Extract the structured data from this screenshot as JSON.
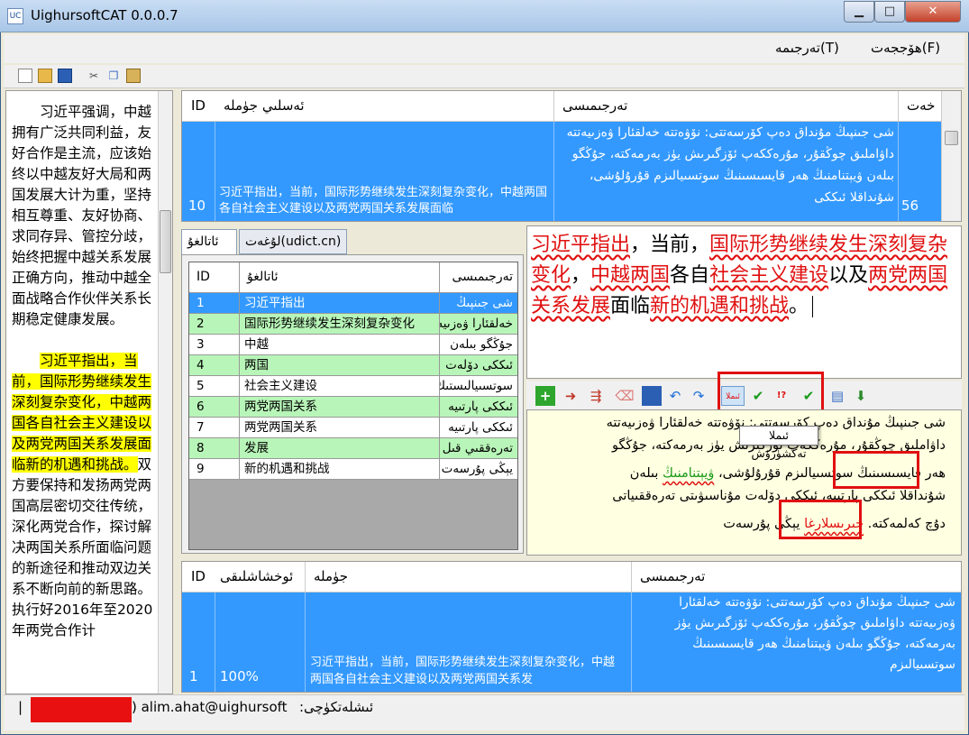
{
  "window": {
    "title": "UighursoftCAT 0.0.0.7",
    "app_icon": "UC",
    "min_symbol": "▁",
    "max_symbol": "□",
    "close_symbol": "✕"
  },
  "menu": {
    "file": "ھۆججەت(F)",
    "translate": "تەرجىمە(T)"
  },
  "toolbar_icons": [
    "new-file-icon",
    "open-folder-icon",
    "save-icon",
    "cut-icon",
    "copy-icon",
    "paste-icon"
  ],
  "left_pane": {
    "para1": "习近平强调，中越拥有广泛共同利益，友好合作是主流，应该始终以中越友好大局和两国发展大计为重，坚持相互尊重、友好协商、求同存异、管控分歧，始终把握中越关系发展正确方向，推动中越全面战略合作伙伴关系长期稳定健康发展。",
    "para2_highlight": "习近平指出，当前，国际形势继续发生深刻复杂变化，中越两国各自社会主义建设以及两党两国关系发展面临新的机遇和挑战。",
    "para2_rest": "双方要保持和发扬两党两国高层密切交往传统，深化两党合作，探讨解决两国关系所面临问题的新途径和推动双边关系不断向前的新思路。执行好2016年至2020年两党合作计"
  },
  "seg_grid": {
    "col_id": "ID",
    "col_source": "ئەسلىي جۈملە",
    "col_target": "تەرجىمىسى",
    "col_chars": "خەت",
    "row": {
      "id": "10",
      "source": "习近平指出，当前，国际形势继续发生深刻复杂变化，中越两国各自社会主义建设以及两党两国关系发展面临",
      "target": "شى جىنپىڭ مۇنداق دەپ كۆرسەتتى: نۆۋەتتە خەلقئارا ۋەزىيەتتە داۋاملىق چوڭقۇر، مۇرەككەپ ئۆزگىرىش يۈز بەرمەكتە، جۇڭگو بىلەن ۋيېتنامنىڭ ھەر قايسىسىنىڭ سوتسىيالىزم قۇرۇلۇشى، شۇنداقلا ئىككى",
      "chars": "56"
    }
  },
  "dict_tabs": {
    "glossary": "ئاتالغۇ",
    "online": "لۇغەت(udict.cn)"
  },
  "dict_grid": {
    "col_id": "ID",
    "col_term": "ئاتالغۇ",
    "col_trans": "تەرجىمىسى",
    "rows": [
      {
        "id": "1",
        "term": "习近平指出",
        "trans": "شى جىنپىڭ"
      },
      {
        "id": "2",
        "term": "国际形势继续发生深刻复杂变化",
        "trans": "خەلقئارا ۋەزىيەت"
      },
      {
        "id": "3",
        "term": "中越",
        "trans": "جۇڭگو بىلەن"
      },
      {
        "id": "4",
        "term": "两国",
        "trans": "ئىككى دۆلەت"
      },
      {
        "id": "5",
        "term": "社会主义建设",
        "trans": "سوتسىيالىستىك"
      },
      {
        "id": "6",
        "term": "两党两国关系",
        "trans": "ئىككى پارتىيە"
      },
      {
        "id": "7",
        "term": "两党两国关系",
        "trans": "ئىككى پارتىيە"
      },
      {
        "id": "8",
        "term": "发展",
        "trans": "تەرەققىي قىل"
      },
      {
        "id": "9",
        "term": "新的机遇和挑战",
        "trans": "يېڭى پۇرسەت"
      }
    ]
  },
  "source_editor": {
    "t1": "习近平指出",
    "t2": "，当前，",
    "t3": "国际形势继续发生深刻复杂变化",
    "t4": "，",
    "t5": "中越两国",
    "t6": "各自",
    "t7": "社会主义建设",
    "t8": "以及",
    "t9": "两党两国关系发展",
    "t10": "面临",
    "t11": "新的机遇和挑战",
    "t12": "。"
  },
  "editor_toolbar": {
    "tooltip": "ئىملا تەكشۈرۈش",
    "spell_label": "ئىملا",
    "icons": [
      "add-icon",
      "insert-icon",
      "export-icon",
      "eraser-icon",
      "save-icon",
      "undo-icon",
      "redo-icon",
      "spellcheck-icon",
      "check-icon",
      "spell-next-icon",
      "check-all-icon",
      "commit-icon",
      "download-icon"
    ]
  },
  "target_editor": {
    "l1": "شى جىنپىڭ مۇنداق دەپ كۆرسەتتى: نۆۋەتتە خەلقئارا ۋەزىيەتتە",
    "l2": "داۋاملىق چوڭقۇر، مۇرەككەپ ئۆزگىرىش يۈز بەرمەكتە، جۇڭگو",
    "l3a": "بىلەن",
    "l3err": "ۋيېتنامنىڭ",
    "l3b": "ھەر قايسىسىنىڭ سوتسىيالىزم قۇرۇلۇشى،",
    "l4": "شۇنداقلا ئىككى پارتىيە، ئىككى دۆلەت مۇناسىۋىتى تەرەققىياتى",
    "l5a": "يېڭى پۇرسەت",
    "l5err": "خىرىسلارغا",
    "l5b": "دۇچ كەلمەكتە."
  },
  "tm_grid": {
    "col_id": "ID",
    "col_match": "ئوخشاشلىقى",
    "col_source": "جۈملە",
    "col_target": "تەرجىمىسى",
    "row": {
      "id": "1",
      "match": "100%",
      "source": "习近平指出，当前，国际形势继续发生深刻复杂变化，中越两国各自社会主义建设以及两党两国关系发",
      "target": "شى جىنپىڭ مۇنداق دەپ كۆرسەتتى: نۆۋەتتە خەلقئارا ۋەزىيەتتە داۋاملىق چوڭقۇر، مۇرەككەپ ئۆزگىرىش يۈز بەرمەكتە، جۇڭگو بىلەن ۋيېتنامنىڭ ھەر قايسىسىنىڭ سوتسىيالىزم"
    }
  },
  "status": {
    "user_label": "ئىشلەتكۈچى:",
    "user": ") alim.ahat@uighursoft",
    "sep": "|"
  }
}
